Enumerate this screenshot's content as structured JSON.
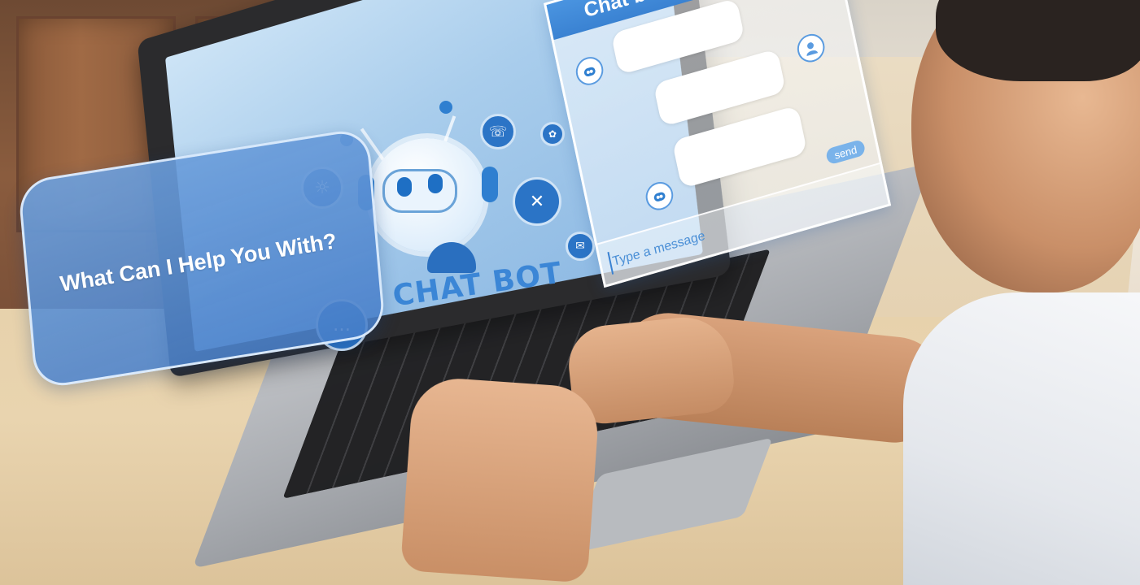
{
  "screen": {
    "robot_label": "CHAT BOT",
    "help_prompt": "What Can I Help You With?"
  },
  "chat_panel": {
    "title": "Chat bot service",
    "close_glyph": "×",
    "input_placeholder": "Type a message",
    "send_label": "send",
    "messages": [
      {
        "sender": "bot"
      },
      {
        "sender": "user"
      },
      {
        "sender": "bot"
      }
    ]
  },
  "icons": {
    "robot": "robot-icon",
    "user_avatar": "user-avatar-icon",
    "bot_avatar": "bot-avatar-icon",
    "chat": "chat-bubble-icon",
    "tools": "tools-icon",
    "mail": "mail-icon",
    "phone_chat": "phone-chat-icon",
    "headset": "headset-icon",
    "brain": "brain-icon"
  },
  "colors": {
    "accent": "#3a82d2",
    "screen_blue": "#a9cdec",
    "bubble_blue": "#5c95d8"
  }
}
